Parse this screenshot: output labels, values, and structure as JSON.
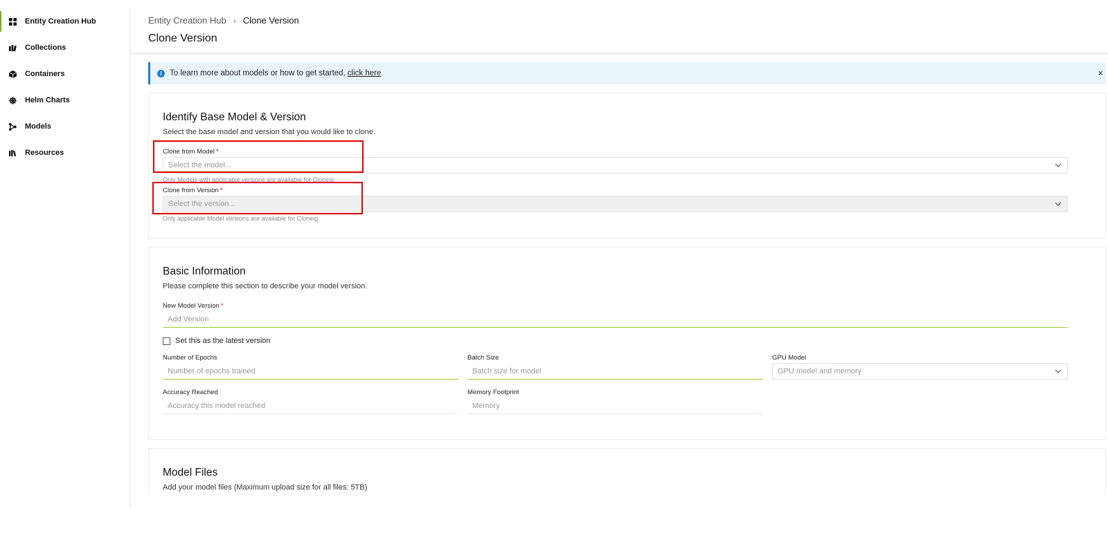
{
  "sidebar": {
    "items": [
      {
        "label": "Entity Creation Hub",
        "icon": "grid-icon"
      },
      {
        "label": "Collections",
        "icon": "collections-icon"
      },
      {
        "label": "Containers",
        "icon": "cube-icon"
      },
      {
        "label": "Helm Charts",
        "icon": "helm-wheel-icon"
      },
      {
        "label": "Models",
        "icon": "network-icon"
      },
      {
        "label": "Resources",
        "icon": "books-icon"
      }
    ]
  },
  "header": {
    "breadcrumb": {
      "parent": "Entity Creation Hub",
      "separator": "›",
      "current": "Clone Version"
    },
    "title": "Clone Version"
  },
  "banner": {
    "icon": "info-icon",
    "text": "To learn more about models or how to get started,",
    "link": "click here",
    "close": "×"
  },
  "identify": {
    "title": "Identify Base Model & Version",
    "subtitle": "Select the base model and version that you would like to clone.",
    "model_label": "Clone from Model",
    "model_placeholder": "Select the model...",
    "model_hint": "Only Models with applicable versions are available for Cloning",
    "version_label": "Clone from Version",
    "version_placeholder": "Select the version...",
    "version_hint": "Only applicable Model versions are available for Cloning",
    "required_mark": "*"
  },
  "basic": {
    "title": "Basic Information",
    "subtitle": "Please complete this section to describe your model version.",
    "version_label": "New Model Version",
    "version_placeholder": "Add Version",
    "latest_label": "Set this as the latest version",
    "epochs_label": "Number of Epochs",
    "epochs_placeholder": "Number of epochs trained",
    "batch_label": "Batch Size",
    "batch_placeholder": "Batch size for model",
    "gpu_label": "GPU Model",
    "gpu_placeholder": "GPU model and memory",
    "accuracy_label": "Accuracy Reached",
    "accuracy_placeholder": "Accuracy this model reached",
    "memory_label": "Memory Footprint",
    "memory_placeholder": "Memory"
  },
  "files": {
    "title": "Model Files",
    "subtitle": "Add your model files (Maximum upload size for all files: 5TB)"
  },
  "colors": {
    "accent": "#76b900",
    "info": "#1f7fd1",
    "highlight": "#e00000",
    "required": "#d0021b"
  }
}
